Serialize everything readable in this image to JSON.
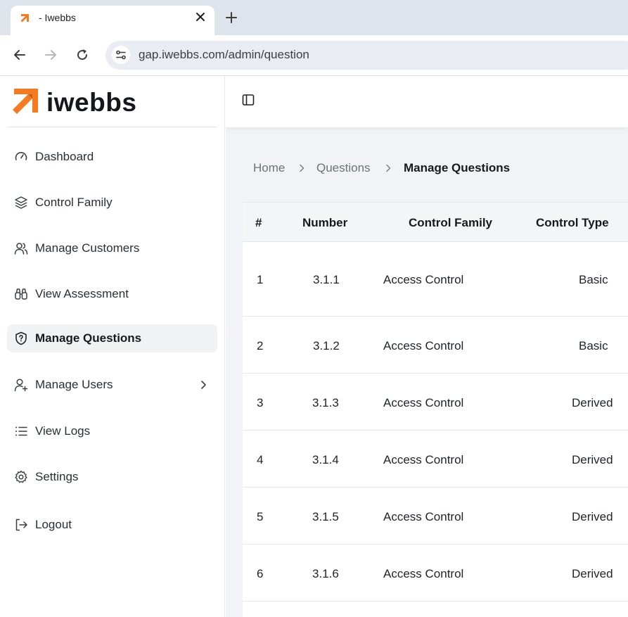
{
  "browser": {
    "tab_title": "- Iwebbs",
    "url": "gap.iwebbs.com/admin/question",
    "icons": [
      "favicon-icon",
      "close-icon",
      "plus-icon",
      "back-arrow-icon",
      "forward-arrow-icon",
      "reload-icon",
      "site-settings-icon"
    ]
  },
  "brand": {
    "name": "iwebbs",
    "accent_color": "#f47b20"
  },
  "sidebar": {
    "items": [
      {
        "label": "Dashboard",
        "icon": "gauge-icon"
      },
      {
        "label": "Control Family",
        "icon": "layers-icon"
      },
      {
        "label": "Manage Customers",
        "icon": "users-icon"
      },
      {
        "label": "View Assessment",
        "icon": "binoculars-icon"
      },
      {
        "label": "Manage Questions",
        "icon": "shield-question-icon",
        "active": true
      },
      {
        "label": "Manage Users",
        "icon": "user-plus-icon",
        "has_submenu": true
      },
      {
        "label": "View Logs",
        "icon": "list-icon"
      },
      {
        "label": "Settings",
        "icon": "gear-icon"
      },
      {
        "label": "Logout",
        "icon": "logout-icon"
      }
    ]
  },
  "breadcrumb": [
    "Home",
    "Questions",
    "Manage Questions"
  ],
  "table": {
    "columns": [
      "#",
      "Number",
      "Control Family",
      "Control Type"
    ],
    "rows": [
      {
        "index": "1",
        "number": "3.1.1",
        "family": "Access Control",
        "type": "Basic"
      },
      {
        "index": "2",
        "number": "3.1.2",
        "family": "Access Control",
        "type": "Basic"
      },
      {
        "index": "3",
        "number": "3.1.3",
        "family": "Access Control",
        "type": "Derived"
      },
      {
        "index": "4",
        "number": "3.1.4",
        "family": "Access Control",
        "type": "Derived"
      },
      {
        "index": "5",
        "number": "3.1.5",
        "family": "Access Control",
        "type": "Derived"
      },
      {
        "index": "6",
        "number": "3.1.6",
        "family": "Access Control",
        "type": "Derived"
      }
    ]
  }
}
